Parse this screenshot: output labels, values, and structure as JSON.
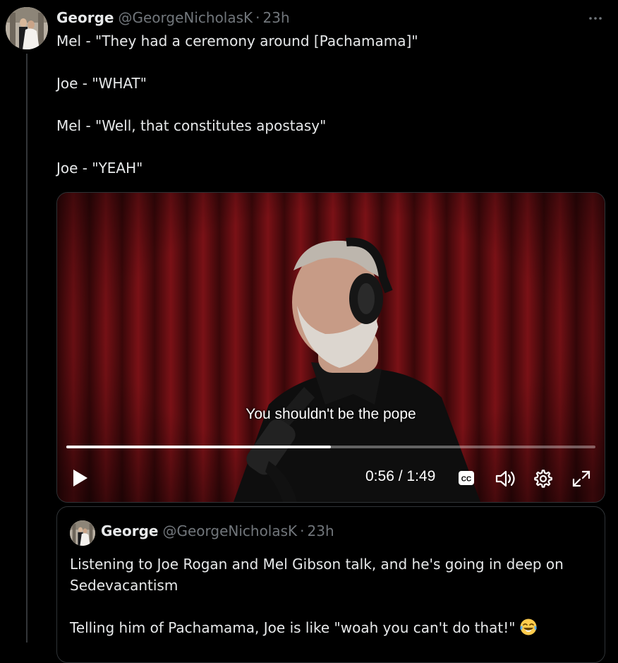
{
  "tweet": {
    "author_name": "George",
    "author_handle": "@GeorgeNicholasK",
    "separator": "·",
    "time": "23h",
    "more_icon": "ellipsis-icon",
    "lines": [
      "Mel - \"They had a ceremony around [Pachamama]\"",
      "Joe - \"WHAT\"",
      "Mel - \"Well, that constitutes apostasy\"",
      "Joe - \"YEAH\""
    ]
  },
  "video": {
    "caption": "You shouldn't be the pope",
    "current_time": "0:56",
    "time_separator": "/",
    "duration": "1:49",
    "progress_fraction": 0.5,
    "cc_label": "CC",
    "controls": [
      "play-icon",
      "cc-icon",
      "volume-icon",
      "settings-icon",
      "fullscreen-icon"
    ]
  },
  "quote": {
    "author_name": "George",
    "author_handle": "@GeorgeNicholasK",
    "separator": "·",
    "time": "23h",
    "line1": "Listening to Joe Rogan and Mel Gibson talk, and he's going in deep on Sedevacantism",
    "line2": "Telling him of Pachamama, Joe is like \"woah you can't do that!\"",
    "emoji": "😂"
  },
  "colors": {
    "background": "#000000",
    "text": "#e7e9ea",
    "secondary": "#71767b",
    "border": "#2f3336"
  }
}
